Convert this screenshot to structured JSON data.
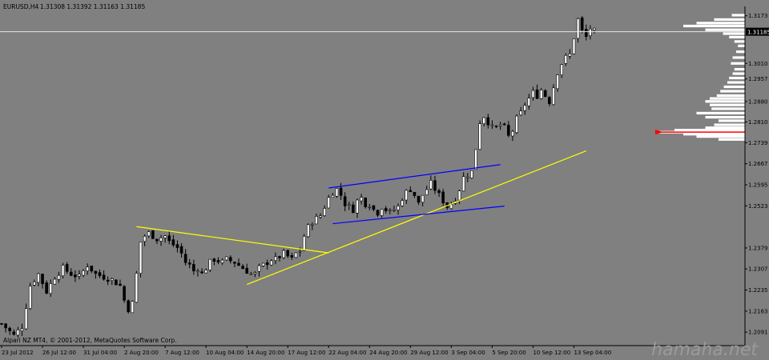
{
  "header": {
    "symbol_tf": "EURUSD,H4",
    "ohlc": "1.31308 1.31392 1.31163 1.31185"
  },
  "footer": {
    "copyright": "Alpari NZ MT4, © 2001-2012, MetaQuotes Software Corp."
  },
  "watermark": "hamaha.net",
  "colors": {
    "background": "#808080",
    "bar": "#000000",
    "bull_body": "#ffffff",
    "bear_body": "#000000",
    "channel_lines": "#0000ff",
    "trend_lines": "#ffff00",
    "volume_profile": "#ffffff",
    "price_line": "#e8e8e8",
    "marker": "#ff0000",
    "axis_text": "#000000"
  },
  "chart_data": {
    "type": "candlestick",
    "symbol": "EURUSD",
    "timeframe": "H4",
    "x_ticks": [
      "23 Jul 2012",
      "26 Jul 12:00",
      "31 Jul 04:00",
      "2 Aug 20:00",
      "7 Aug 12:00",
      "10 Aug 04:00",
      "14 Aug 20:00",
      "17 Aug 12:00",
      "22 Aug 04:00",
      "24 Aug 20:00",
      "29 Aug 12:00",
      "3 Sep 04:00",
      "5 Sep 20:00",
      "10 Sep 12:00",
      "13 Sep 04:00"
    ],
    "y_ticks": [
      1.3173,
      1.301,
      1.2957,
      1.288,
      1.281,
      1.2739,
      1.2667,
      1.2595,
      1.2523,
      1.2379,
      1.2307,
      1.2235,
      1.2163,
      1.2091
    ],
    "y_lim": [
      1.2045,
      1.3205
    ],
    "current_price": 1.31185,
    "current_price_label": "1.31185",
    "close_path": [
      [
        0,
        1.212
      ],
      [
        3,
        1.208
      ],
      [
        5,
        1.211
      ],
      [
        7,
        1.225
      ],
      [
        9,
        1.229
      ],
      [
        11,
        1.223
      ],
      [
        13,
        1.228
      ],
      [
        15,
        1.231
      ],
      [
        17,
        1.229
      ],
      [
        19,
        1.228
      ],
      [
        21,
        1.232
      ],
      [
        23,
        1.229
      ],
      [
        25,
        1.228
      ],
      [
        27,
        1.227
      ],
      [
        29,
        1.225
      ],
      [
        30,
        1.22
      ],
      [
        31,
        1.217
      ],
      [
        32,
        1.219
      ],
      [
        33,
        1.229
      ],
      [
        34,
        1.24
      ],
      [
        35,
        1.242
      ],
      [
        36,
        1.243
      ],
      [
        38,
        1.241
      ],
      [
        40,
        1.242
      ],
      [
        41,
        1.24
      ],
      [
        42,
        1.239
      ],
      [
        43,
        1.238
      ],
      [
        44,
        1.236
      ],
      [
        45,
        1.233
      ],
      [
        46,
        1.232
      ],
      [
        47,
        1.23
      ],
      [
        48,
        1.231
      ],
      [
        49,
        1.229
      ],
      [
        50,
        1.231
      ],
      [
        51,
        1.233
      ],
      [
        52,
        1.234
      ],
      [
        54,
        1.233
      ],
      [
        55,
        1.234
      ],
      [
        57,
        1.233
      ],
      [
        59,
        1.231
      ],
      [
        60,
        1.23
      ],
      [
        61,
        1.229
      ],
      [
        62,
        1.229
      ],
      [
        63,
        1.231
      ],
      [
        64,
        1.232
      ],
      [
        65,
        1.233
      ],
      [
        66,
        1.234
      ],
      [
        67,
        1.234
      ],
      [
        68,
        1.235
      ],
      [
        69,
        1.236
      ],
      [
        70,
        1.235
      ],
      [
        71,
        1.234
      ],
      [
        72,
        1.236
      ],
      [
        73,
        1.237
      ],
      [
        74,
        1.242
      ],
      [
        75,
        1.245
      ],
      [
        76,
        1.247
      ],
      [
        77,
        1.248
      ],
      [
        78,
        1.249
      ],
      [
        79,
        1.252
      ],
      [
        80,
        1.255
      ],
      [
        81,
        1.257
      ],
      [
        82,
        1.258
      ],
      [
        83,
        1.256
      ],
      [
        84,
        1.253
      ],
      [
        85,
        1.252
      ],
      [
        86,
        1.251
      ],
      [
        87,
        1.254
      ],
      [
        88,
        1.255
      ],
      [
        89,
        1.253
      ],
      [
        90,
        1.253
      ],
      [
        91,
        1.251
      ],
      [
        92,
        1.25
      ],
      [
        93,
        1.252
      ],
      [
        94,
        1.251
      ],
      [
        95,
        1.25
      ],
      [
        96,
        1.251
      ],
      [
        97,
        1.252
      ],
      [
        98,
        1.255
      ],
      [
        99,
        1.257
      ],
      [
        100,
        1.258
      ],
      [
        101,
        1.256
      ],
      [
        102,
        1.253
      ],
      [
        103,
        1.256
      ],
      [
        104,
        1.258
      ],
      [
        105,
        1.26
      ],
      [
        106,
        1.258
      ],
      [
        107,
        1.256
      ],
      [
        108,
        1.254
      ],
      [
        109,
        1.252
      ],
      [
        110,
        1.253
      ],
      [
        111,
        1.255
      ],
      [
        112,
        1.258
      ],
      [
        113,
        1.262
      ],
      [
        114,
        1.263
      ],
      [
        115,
        1.264
      ],
      [
        116,
        1.272
      ],
      [
        117,
        1.281
      ],
      [
        118,
        1.283
      ],
      [
        119,
        1.281
      ],
      [
        120,
        1.279
      ],
      [
        121,
        1.279
      ],
      [
        122,
        1.28
      ],
      [
        123,
        1.279
      ],
      [
        124,
        1.276
      ],
      [
        125,
        1.278
      ],
      [
        126,
        1.282
      ],
      [
        127,
        1.284
      ],
      [
        128,
        1.287
      ],
      [
        129,
        1.289
      ],
      [
        130,
        1.291
      ],
      [
        131,
        1.29
      ],
      [
        132,
        1.292
      ],
      [
        133,
        1.29
      ],
      [
        134,
        1.288
      ],
      [
        135,
        1.293
      ],
      [
        136,
        1.298
      ],
      [
        137,
        1.301
      ],
      [
        138,
        1.303
      ],
      [
        139,
        1.304
      ],
      [
        140,
        1.31
      ],
      [
        141,
        1.316
      ],
      [
        142,
        1.312
      ],
      [
        143,
        1.31
      ],
      [
        144,
        1.313
      ],
      [
        145,
        1.312
      ]
    ],
    "trend_lines": [
      {
        "color": "yellow",
        "from": [
          33,
          1.2452
        ],
        "to": [
          80,
          1.2362
        ]
      },
      {
        "color": "yellow",
        "from": [
          60,
          1.2254
        ],
        "to": [
          143,
          1.2711
        ]
      },
      {
        "color": "blue",
        "from": [
          80,
          1.2584
        ],
        "to": [
          122,
          1.2664
        ]
      },
      {
        "color": "blue",
        "from": [
          81,
          1.2462
        ],
        "to": [
          123,
          1.2522
        ]
      }
    ],
    "volume_profile": {
      "color": "white",
      "peak_price": 1.2775,
      "levels": [
        [
          1.3175,
          0.15
        ],
        [
          1.316,
          0.35
        ],
        [
          1.3148,
          0.55
        ],
        [
          1.3138,
          0.7
        ],
        [
          1.3125,
          0.45
        ],
        [
          1.3112,
          0.25
        ],
        [
          1.31,
          0.18
        ],
        [
          1.3085,
          0.12
        ],
        [
          1.307,
          0.08
        ],
        [
          1.305,
          0.1
        ],
        [
          1.303,
          0.14
        ],
        [
          1.301,
          0.16
        ],
        [
          1.299,
          0.12
        ],
        [
          1.2975,
          0.14
        ],
        [
          1.296,
          0.18
        ],
        [
          1.2945,
          0.2
        ],
        [
          1.293,
          0.24
        ],
        [
          1.2915,
          0.28
        ],
        [
          1.29,
          0.32
        ],
        [
          1.289,
          0.4
        ],
        [
          1.288,
          0.45
        ],
        [
          1.2868,
          0.4
        ],
        [
          1.2855,
          0.38
        ],
        [
          1.284,
          0.55
        ],
        [
          1.2826,
          0.45
        ],
        [
          1.2814,
          0.3
        ],
        [
          1.28,
          0.35
        ],
        [
          1.279,
          0.45
        ],
        [
          1.2782,
          0.8
        ],
        [
          1.2775,
          1.0
        ],
        [
          1.2768,
          0.7
        ],
        [
          1.276,
          0.55
        ],
        [
          1.275,
          0.3
        ]
      ]
    }
  }
}
